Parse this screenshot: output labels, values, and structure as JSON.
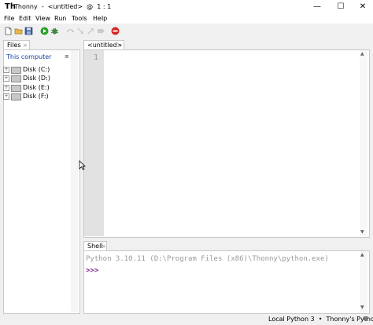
{
  "window": {
    "app_icon_text": "Th",
    "title": "Thonny  -  <untitled>  @  1 : 1",
    "minimize_glyph": "—",
    "maximize_glyph": "☐",
    "close_glyph": "✕"
  },
  "menu": {
    "items": [
      "File",
      "Edit",
      "View",
      "Run",
      "Tools",
      "Help"
    ]
  },
  "toolbar": {
    "buttons": [
      "new-file-icon",
      "open-file-icon",
      "save-icon",
      "run-icon",
      "debug-icon",
      "step-over-icon",
      "step-into-icon",
      "step-out-icon",
      "resume-icon",
      "stop-icon"
    ],
    "colors": {
      "run": "#2aa12a",
      "stop": "#d42323",
      "disabled": "#c9c9c9"
    }
  },
  "files": {
    "tab_label": "Files",
    "tab_close": "×",
    "root_label": "This computer",
    "menu_glyph": "≡",
    "disks": [
      "Disk (C:)",
      "Disk (D:)",
      "Disk (E:)",
      "Disk (F:)"
    ],
    "expand_glyph": "+"
  },
  "editor": {
    "tab_label": "<untitled>",
    "tab_close": "×",
    "line_number": "1",
    "scroll_up": "▲",
    "scroll_down": "▼"
  },
  "shell": {
    "tab_label": "Shell",
    "tab_close": "×",
    "version_line": "Python 3.10.11 (D:\\Program Files (x86)\\Thonny\\python.exe)",
    "prompt": ">>>",
    "scroll_up": "▲",
    "scroll_down": "▼"
  },
  "status": {
    "interpreter": "Local Python 3  •  Thonny's Python"
  }
}
